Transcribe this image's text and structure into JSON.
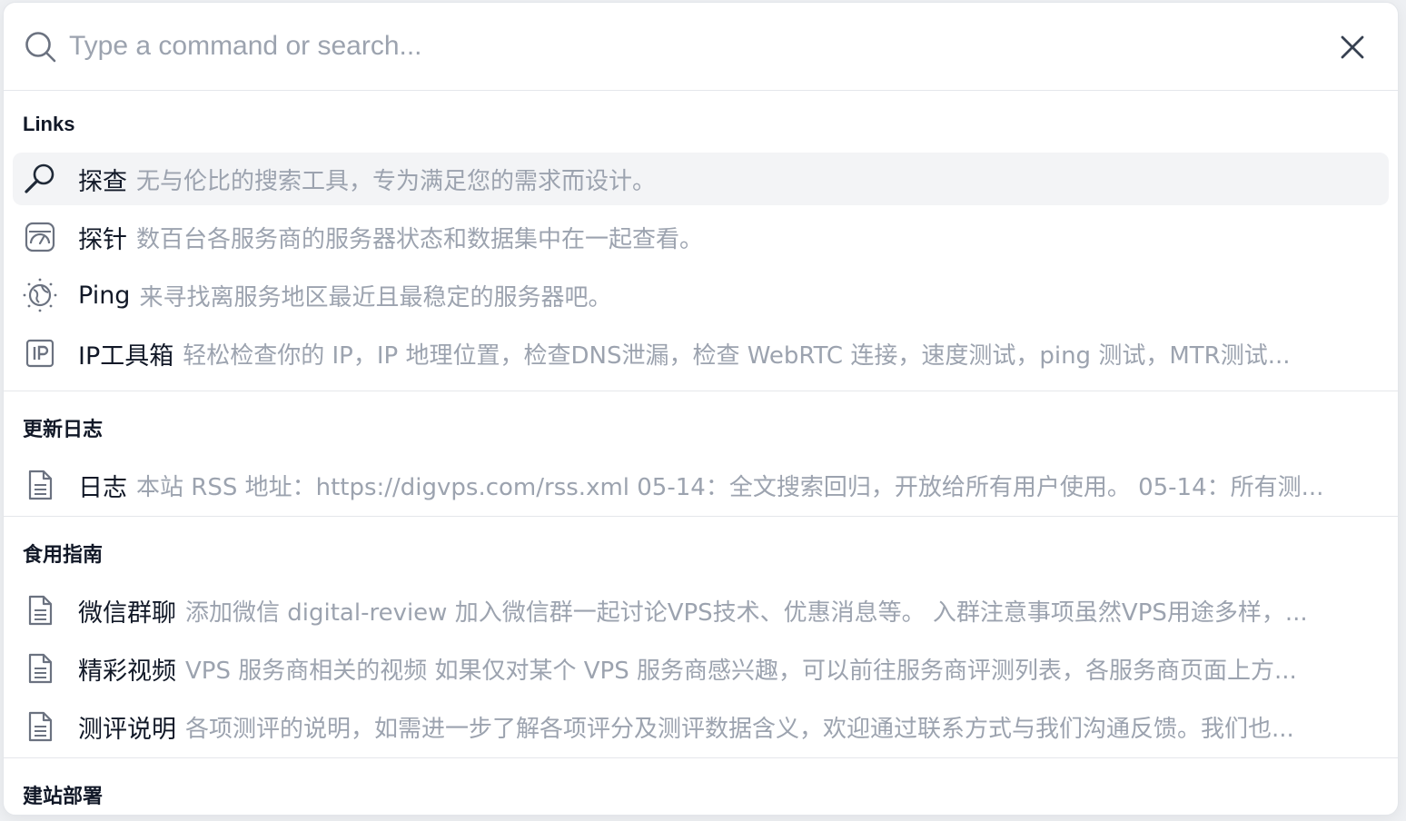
{
  "search": {
    "placeholder": "Type a command or search...",
    "value": ""
  },
  "groups": [
    {
      "heading": "Links",
      "items": [
        {
          "icon": "magnifier-icon",
          "title": "探查",
          "desc": "无与伦比的搜索工具，专为满足您的需求而设计。",
          "active": true
        },
        {
          "icon": "gauge-icon",
          "title": "探针",
          "desc": "数百台各服务商的服务器状态和数据集中在一起查看。"
        },
        {
          "icon": "globe-icon",
          "title": "Ping",
          "desc": "来寻找离服务地区最近且最稳定的服务器吧。"
        },
        {
          "icon": "ip-icon",
          "title": "IP工具箱",
          "desc": "轻松检查你的 IP，IP 地理位置，检查DNS泄漏，检查 WebRTC 连接，速度测试，ping 测试，MTR测试..."
        }
      ]
    },
    {
      "heading": "更新日志",
      "items": [
        {
          "icon": "document-icon",
          "title": "日志",
          "desc": "本站 RSS 地址：https://digvps.com/rss.xml 05-14：全文搜索回归，开放给所有用户使用。 05-14：所有测..."
        }
      ]
    },
    {
      "heading": "食用指南",
      "items": [
        {
          "icon": "document-icon",
          "title": "微信群聊",
          "desc": "添加微信 digital-review 加入微信群一起讨论VPS技术、优惠消息等。 入群注意事项虽然VPS用途多样，..."
        },
        {
          "icon": "document-icon",
          "title": "精彩视频",
          "desc": "VPS 服务商相关的视频 如果仅对某个 VPS 服务商感兴趣，可以前往服务商评测列表，各服务商页面上方..."
        },
        {
          "icon": "document-icon",
          "title": "测评说明",
          "desc": "各项测评的说明，如需进一步了解各项评分及测评数据含义，欢迎通过联系方式与我们沟通反馈。我们也..."
        }
      ]
    },
    {
      "heading": "建站部署",
      "items": []
    }
  ]
}
